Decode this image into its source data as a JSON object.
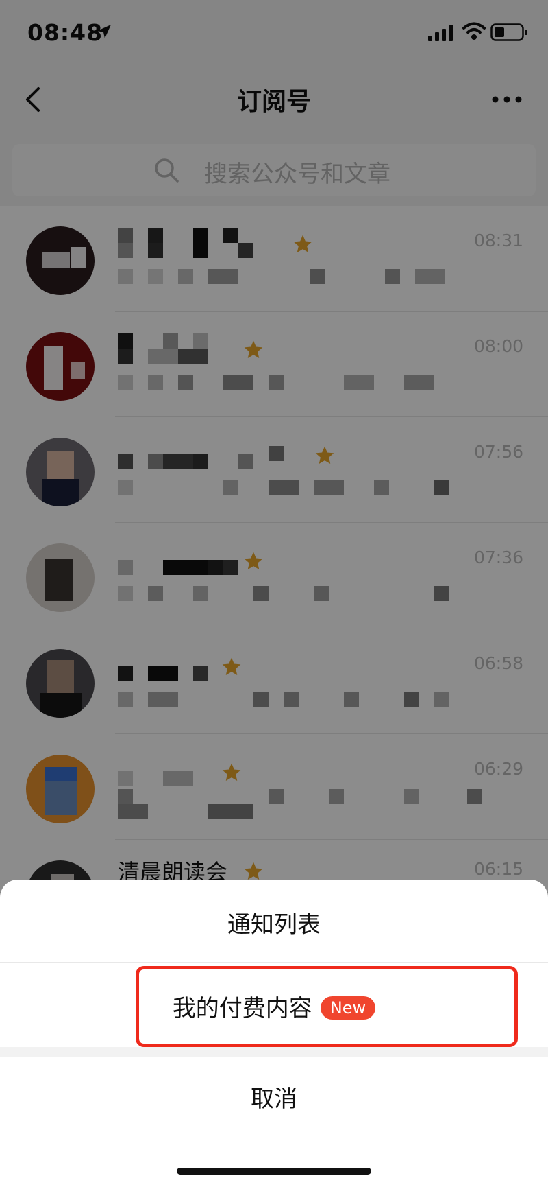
{
  "status_bar": {
    "time": "08:48"
  },
  "nav": {
    "title": "订阅号"
  },
  "search": {
    "placeholder": "搜索公众号和文章"
  },
  "list": {
    "items": [
      {
        "time": "08:31"
      },
      {
        "time": "08:00"
      },
      {
        "time": "07:56"
      },
      {
        "time": "07:36"
      },
      {
        "time": "06:58"
      },
      {
        "time": "06:29"
      },
      {
        "name": "清晨朗读会",
        "time": "06:15"
      }
    ]
  },
  "sheet": {
    "notify_label": "通知列表",
    "paid_label": "我的付费内容",
    "new_badge": "New",
    "cancel_label": "取消"
  },
  "colors": {
    "accent_red": "#ef2a1c",
    "badge_red": "#f0452e",
    "star": "#e5a52a"
  }
}
